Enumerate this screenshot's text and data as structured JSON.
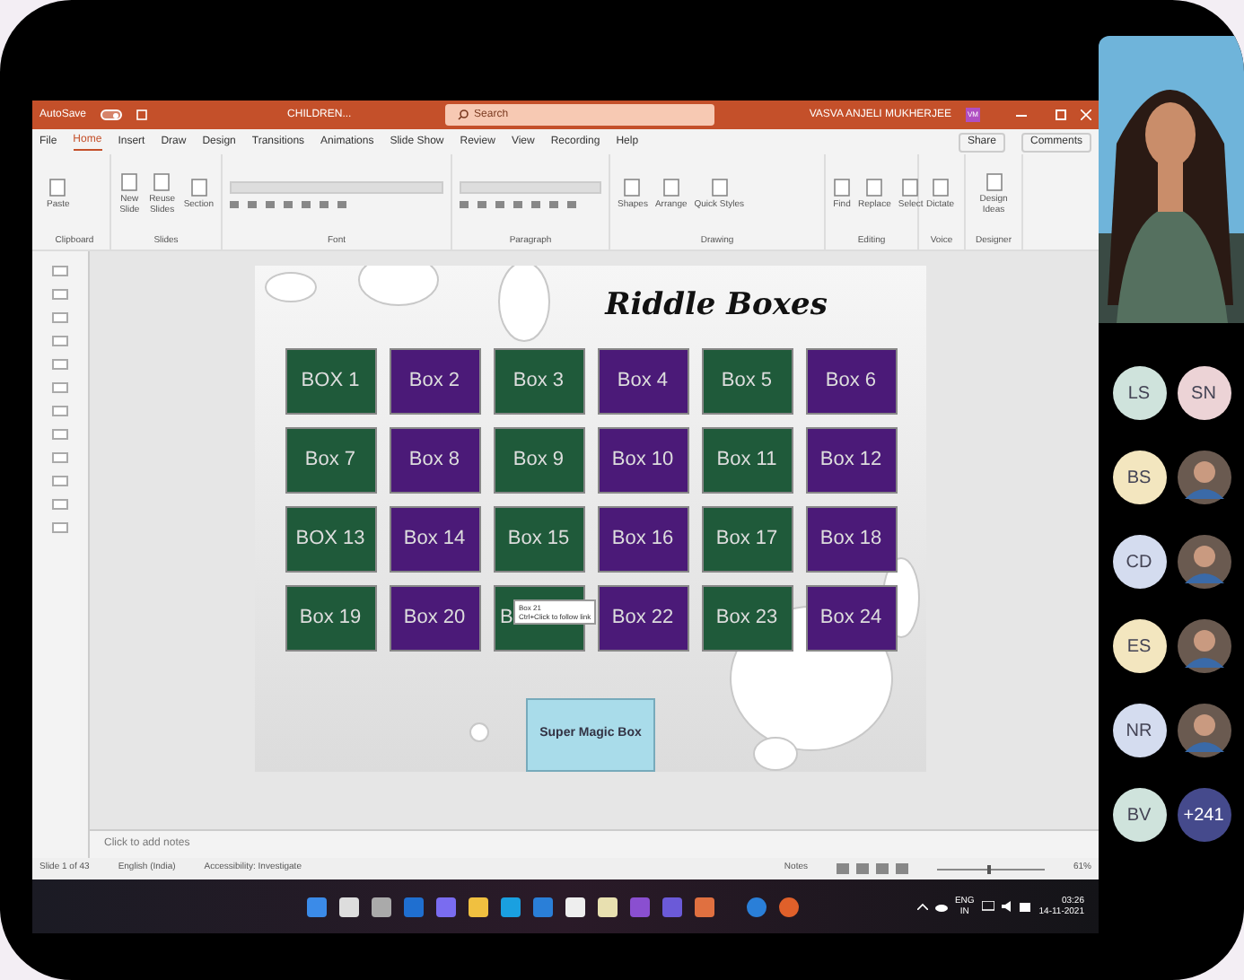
{
  "window": {
    "autosave": "AutoSave",
    "autosave_on": true,
    "title": "CHILDREN...",
    "search": {
      "placeholder": "Search"
    },
    "user": "VASVA ANJELI MUKHERJEE",
    "user_initials": "VM"
  },
  "tabs": [
    {
      "label": "File",
      "selected": false
    },
    {
      "label": "Home",
      "selected": true
    },
    {
      "label": "Insert",
      "selected": false
    },
    {
      "label": "Draw",
      "selected": false
    },
    {
      "label": "Design",
      "selected": false
    },
    {
      "label": "Transitions",
      "selected": false
    },
    {
      "label": "Animations",
      "selected": false
    },
    {
      "label": "Slide Show",
      "selected": false
    },
    {
      "label": "Review",
      "selected": false
    },
    {
      "label": "View",
      "selected": false
    },
    {
      "label": "Recording",
      "selected": false
    },
    {
      "label": "Help",
      "selected": false
    }
  ],
  "share": "Share",
  "comments": "Comments",
  "ribbon_groups": [
    {
      "label": "Clipboard",
      "buttons": [
        "Paste"
      ]
    },
    {
      "label": "Slides",
      "buttons": [
        "New Slide",
        "Reuse Slides",
        "Section"
      ]
    },
    {
      "label": "Font"
    },
    {
      "label": "Paragraph"
    },
    {
      "label": "Drawing",
      "buttons": [
        "Shapes",
        "Arrange",
        "Quick Styles"
      ]
    },
    {
      "label": "Editing",
      "buttons": [
        "Find",
        "Replace",
        "Select"
      ]
    },
    {
      "label": "Voice",
      "buttons": [
        "Dictate"
      ]
    },
    {
      "label": "Designer",
      "buttons": [
        "Design Ideas"
      ]
    }
  ],
  "slide": {
    "title": "Riddle Boxes",
    "boxes": [
      {
        "label": "BOX 1",
        "color": "#1f5a3a"
      },
      {
        "label": "Box 2",
        "color": "#4b1a78"
      },
      {
        "label": "Box 3",
        "color": "#1f5a3a"
      },
      {
        "label": "Box 4",
        "color": "#4b1a78"
      },
      {
        "label": "Box 5",
        "color": "#1f5a3a"
      },
      {
        "label": "Box 6",
        "color": "#4b1a78"
      },
      {
        "label": "Box 7",
        "color": "#1f5a3a"
      },
      {
        "label": "Box 8",
        "color": "#4b1a78"
      },
      {
        "label": "Box 9",
        "color": "#1f5a3a"
      },
      {
        "label": "Box 10",
        "color": "#4b1a78"
      },
      {
        "label": "Box 11",
        "color": "#1f5a3a"
      },
      {
        "label": "Box 12",
        "color": "#4b1a78"
      },
      {
        "label": "BOX 13",
        "color": "#1f5a3a"
      },
      {
        "label": "Box 14",
        "color": "#4b1a78"
      },
      {
        "label": "Box 15",
        "color": "#1f5a3a"
      },
      {
        "label": "Box 16",
        "color": "#4b1a78"
      },
      {
        "label": "Box 17",
        "color": "#1f5a3a"
      },
      {
        "label": "Box 18",
        "color": "#4b1a78"
      },
      {
        "label": "Box 19",
        "color": "#1f5a3a"
      },
      {
        "label": "Box 20",
        "color": "#4b1a78"
      },
      {
        "label": "B",
        "color": "#1f5a3a"
      },
      {
        "label": "Box 22",
        "color": "#4b1a78"
      },
      {
        "label": "Box 23",
        "color": "#1f5a3a"
      },
      {
        "label": "Box 24",
        "color": "#4b1a78"
      }
    ],
    "tooltip": {
      "title": "Box 21",
      "hint": "Ctrl+Click to follow link"
    },
    "magic_box": "Super Magic Box"
  },
  "notes": {
    "placeholder": "Click to add notes"
  },
  "status_bar": {
    "slide": "Slide 1 of 43",
    "language": "English (India)",
    "accessibility": "Accessibility: Investigate",
    "notes": "Notes",
    "zoom": "61%",
    "zoom_slider": {
      "level": 0.48
    }
  },
  "taskbar": {
    "language": "ENG",
    "region": "IN",
    "time": "03:26",
    "date": "14-11-2021"
  },
  "participants": [
    {
      "initials": "LS",
      "color": "#cfe3dc"
    },
    {
      "initials": "SN",
      "color": "#ecd3d6"
    },
    {
      "initials": "BS",
      "color": "#f3e6bf"
    },
    {
      "kind": "picture"
    },
    {
      "initials": "CD",
      "color": "#d4dcef"
    },
    {
      "kind": "picture"
    },
    {
      "initials": "ES",
      "color": "#f3e6bf"
    },
    {
      "kind": "picture"
    },
    {
      "initials": "NR",
      "color": "#d4dcef"
    },
    {
      "kind": "picture"
    },
    {
      "initials": "BV",
      "color": "#cfe3dc"
    },
    {
      "initials": "+241",
      "color": "#454a8c"
    }
  ]
}
